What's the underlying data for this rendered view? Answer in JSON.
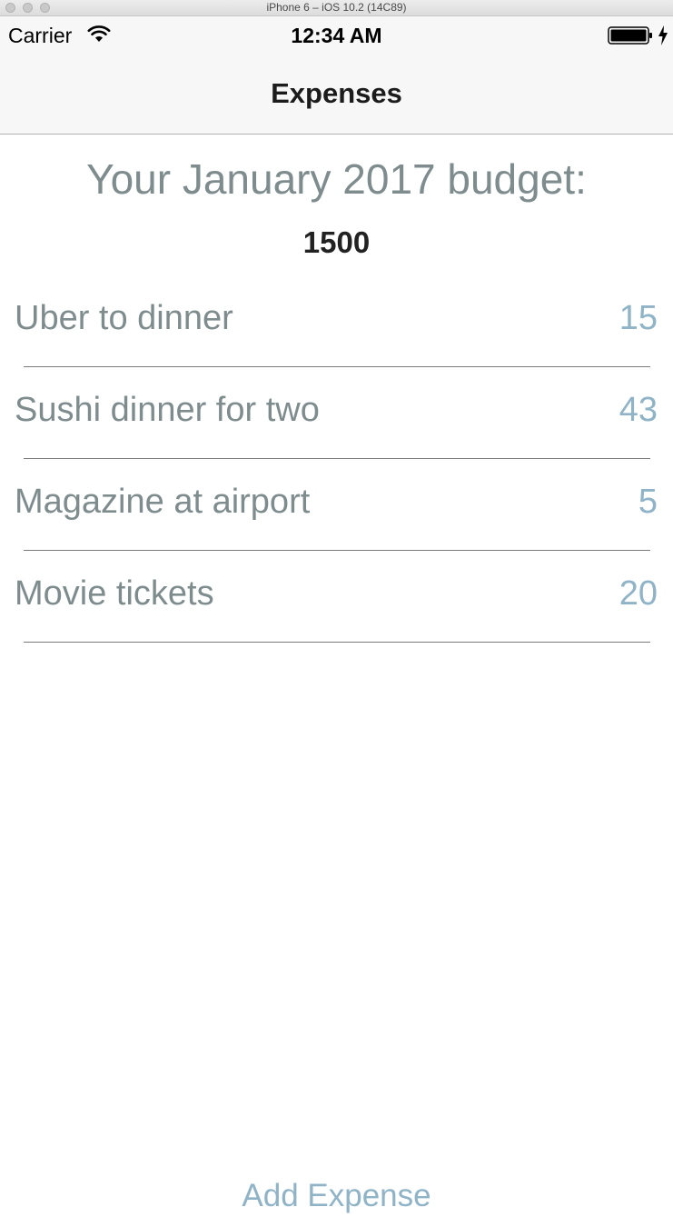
{
  "window": {
    "title": "iPhone 6 – iOS 10.2 (14C89)"
  },
  "status_bar": {
    "carrier": "Carrier",
    "time": "12:34 AM",
    "icons": [
      "wifi-icon",
      "battery-icon",
      "charging-bolt-icon"
    ]
  },
  "nav": {
    "title": "Expenses"
  },
  "budget": {
    "heading": "Your January 2017 budget:",
    "amount": "1500"
  },
  "expenses": [
    {
      "name": "Uber to dinner",
      "amount": "15"
    },
    {
      "name": "Sushi dinner for two",
      "amount": "43"
    },
    {
      "name": "Magazine at airport",
      "amount": "5"
    },
    {
      "name": "Movie tickets",
      "amount": "20"
    }
  ],
  "actions": {
    "add_label": "Add Expense"
  },
  "colors": {
    "label_gray": "#7f8c8d",
    "accent_blue": "#8fb3c7",
    "bar_bg": "#f7f7f7"
  }
}
